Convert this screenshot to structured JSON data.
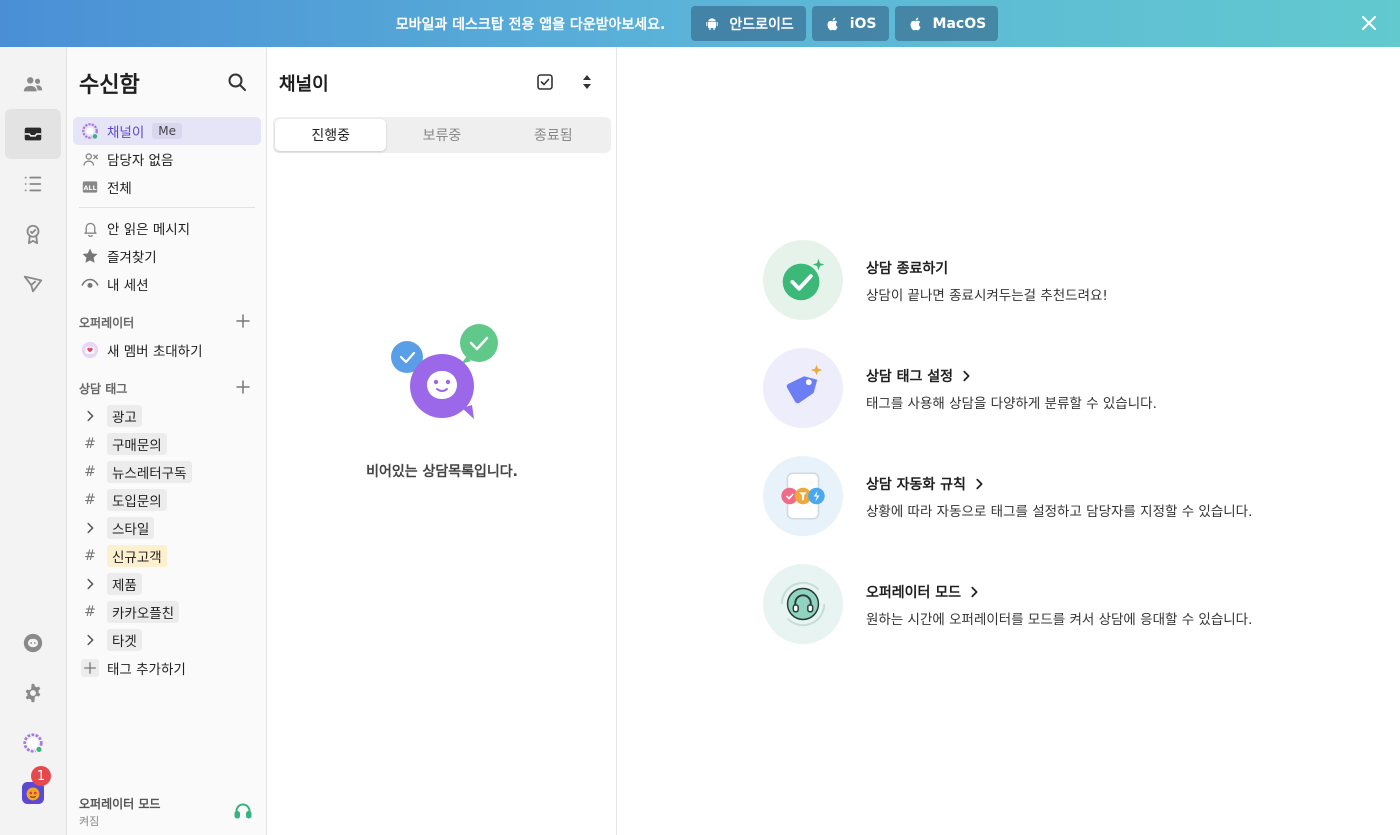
{
  "banner": {
    "text": "모바일과 데스크탑 전용 앱을 다운받아보세요.",
    "buttons": [
      {
        "label": "안드로이드",
        "icon": "android-icon"
      },
      {
        "label": "iOS",
        "icon": "apple-icon"
      },
      {
        "label": "MacOS",
        "icon": "apple-icon"
      }
    ]
  },
  "rail": {
    "notification_count": "1"
  },
  "sidebar": {
    "title": "수신함",
    "inbox_items": [
      {
        "label": "채널이",
        "badge": "Me"
      },
      {
        "label": "담당자 없음"
      },
      {
        "label": "전체"
      }
    ],
    "filter_items": [
      {
        "label": "안 읽은 메시지"
      },
      {
        "label": "즐겨찾기"
      },
      {
        "label": "내 세션"
      }
    ],
    "operators_section": "오퍼레이터",
    "invite_label": "새 멤버 초대하기",
    "tags_section": "상담 태그",
    "tags": [
      {
        "label": "광고",
        "expandable": true
      },
      {
        "label": "구매문의",
        "expandable": false
      },
      {
        "label": "뉴스레터구독",
        "expandable": false
      },
      {
        "label": "도입문의",
        "expandable": false
      },
      {
        "label": "스타일",
        "expandable": true
      },
      {
        "label": "신규고객",
        "expandable": false
      },
      {
        "label": "제품",
        "expandable": true
      },
      {
        "label": "카카오플친",
        "expandable": false
      },
      {
        "label": "타겟",
        "expandable": true
      }
    ],
    "add_tag_label": "태그 추가하기",
    "footer": {
      "title": "오퍼레이터 모드",
      "status": "켜짐"
    }
  },
  "middle": {
    "title": "채널이",
    "tabs": [
      "진행중",
      "보류중",
      "종료됨"
    ],
    "active_tab": 0,
    "empty_text": "비어있는 상담목록입니다."
  },
  "features": [
    {
      "title": "상담 종료하기",
      "desc": "상담이 끝나면 종료시켜두는걸 추천드려요!",
      "chevron": false,
      "bg": "#e6f3ea",
      "icon": "check-circle-icon"
    },
    {
      "title": "상담 태그 설정",
      "desc": "태그를 사용해 상담을 다양하게 분류할 수 있습니다.",
      "chevron": true,
      "bg": "#eeedfb",
      "icon": "tag-icon"
    },
    {
      "title": "상담 자동화 규칙",
      "desc": "상황에 따라 자동으로 태그를 설정하고 담당자를 지정할 수 있습니다.",
      "chevron": true,
      "bg": "#e8f2fb",
      "icon": "automation-icon"
    },
    {
      "title": "오퍼레이터 모드",
      "desc": "원하는 시간에 오퍼레이터를 모드를 켜서 상담에 응대할 수 있습니다.",
      "chevron": true,
      "bg": "#e7f4f1",
      "icon": "headset-icon"
    }
  ],
  "colors": {
    "accent": "#5b4ad1",
    "online": "#36b37e",
    "banner_start": "#4a8fd6",
    "banner_end": "#62c9cf"
  }
}
